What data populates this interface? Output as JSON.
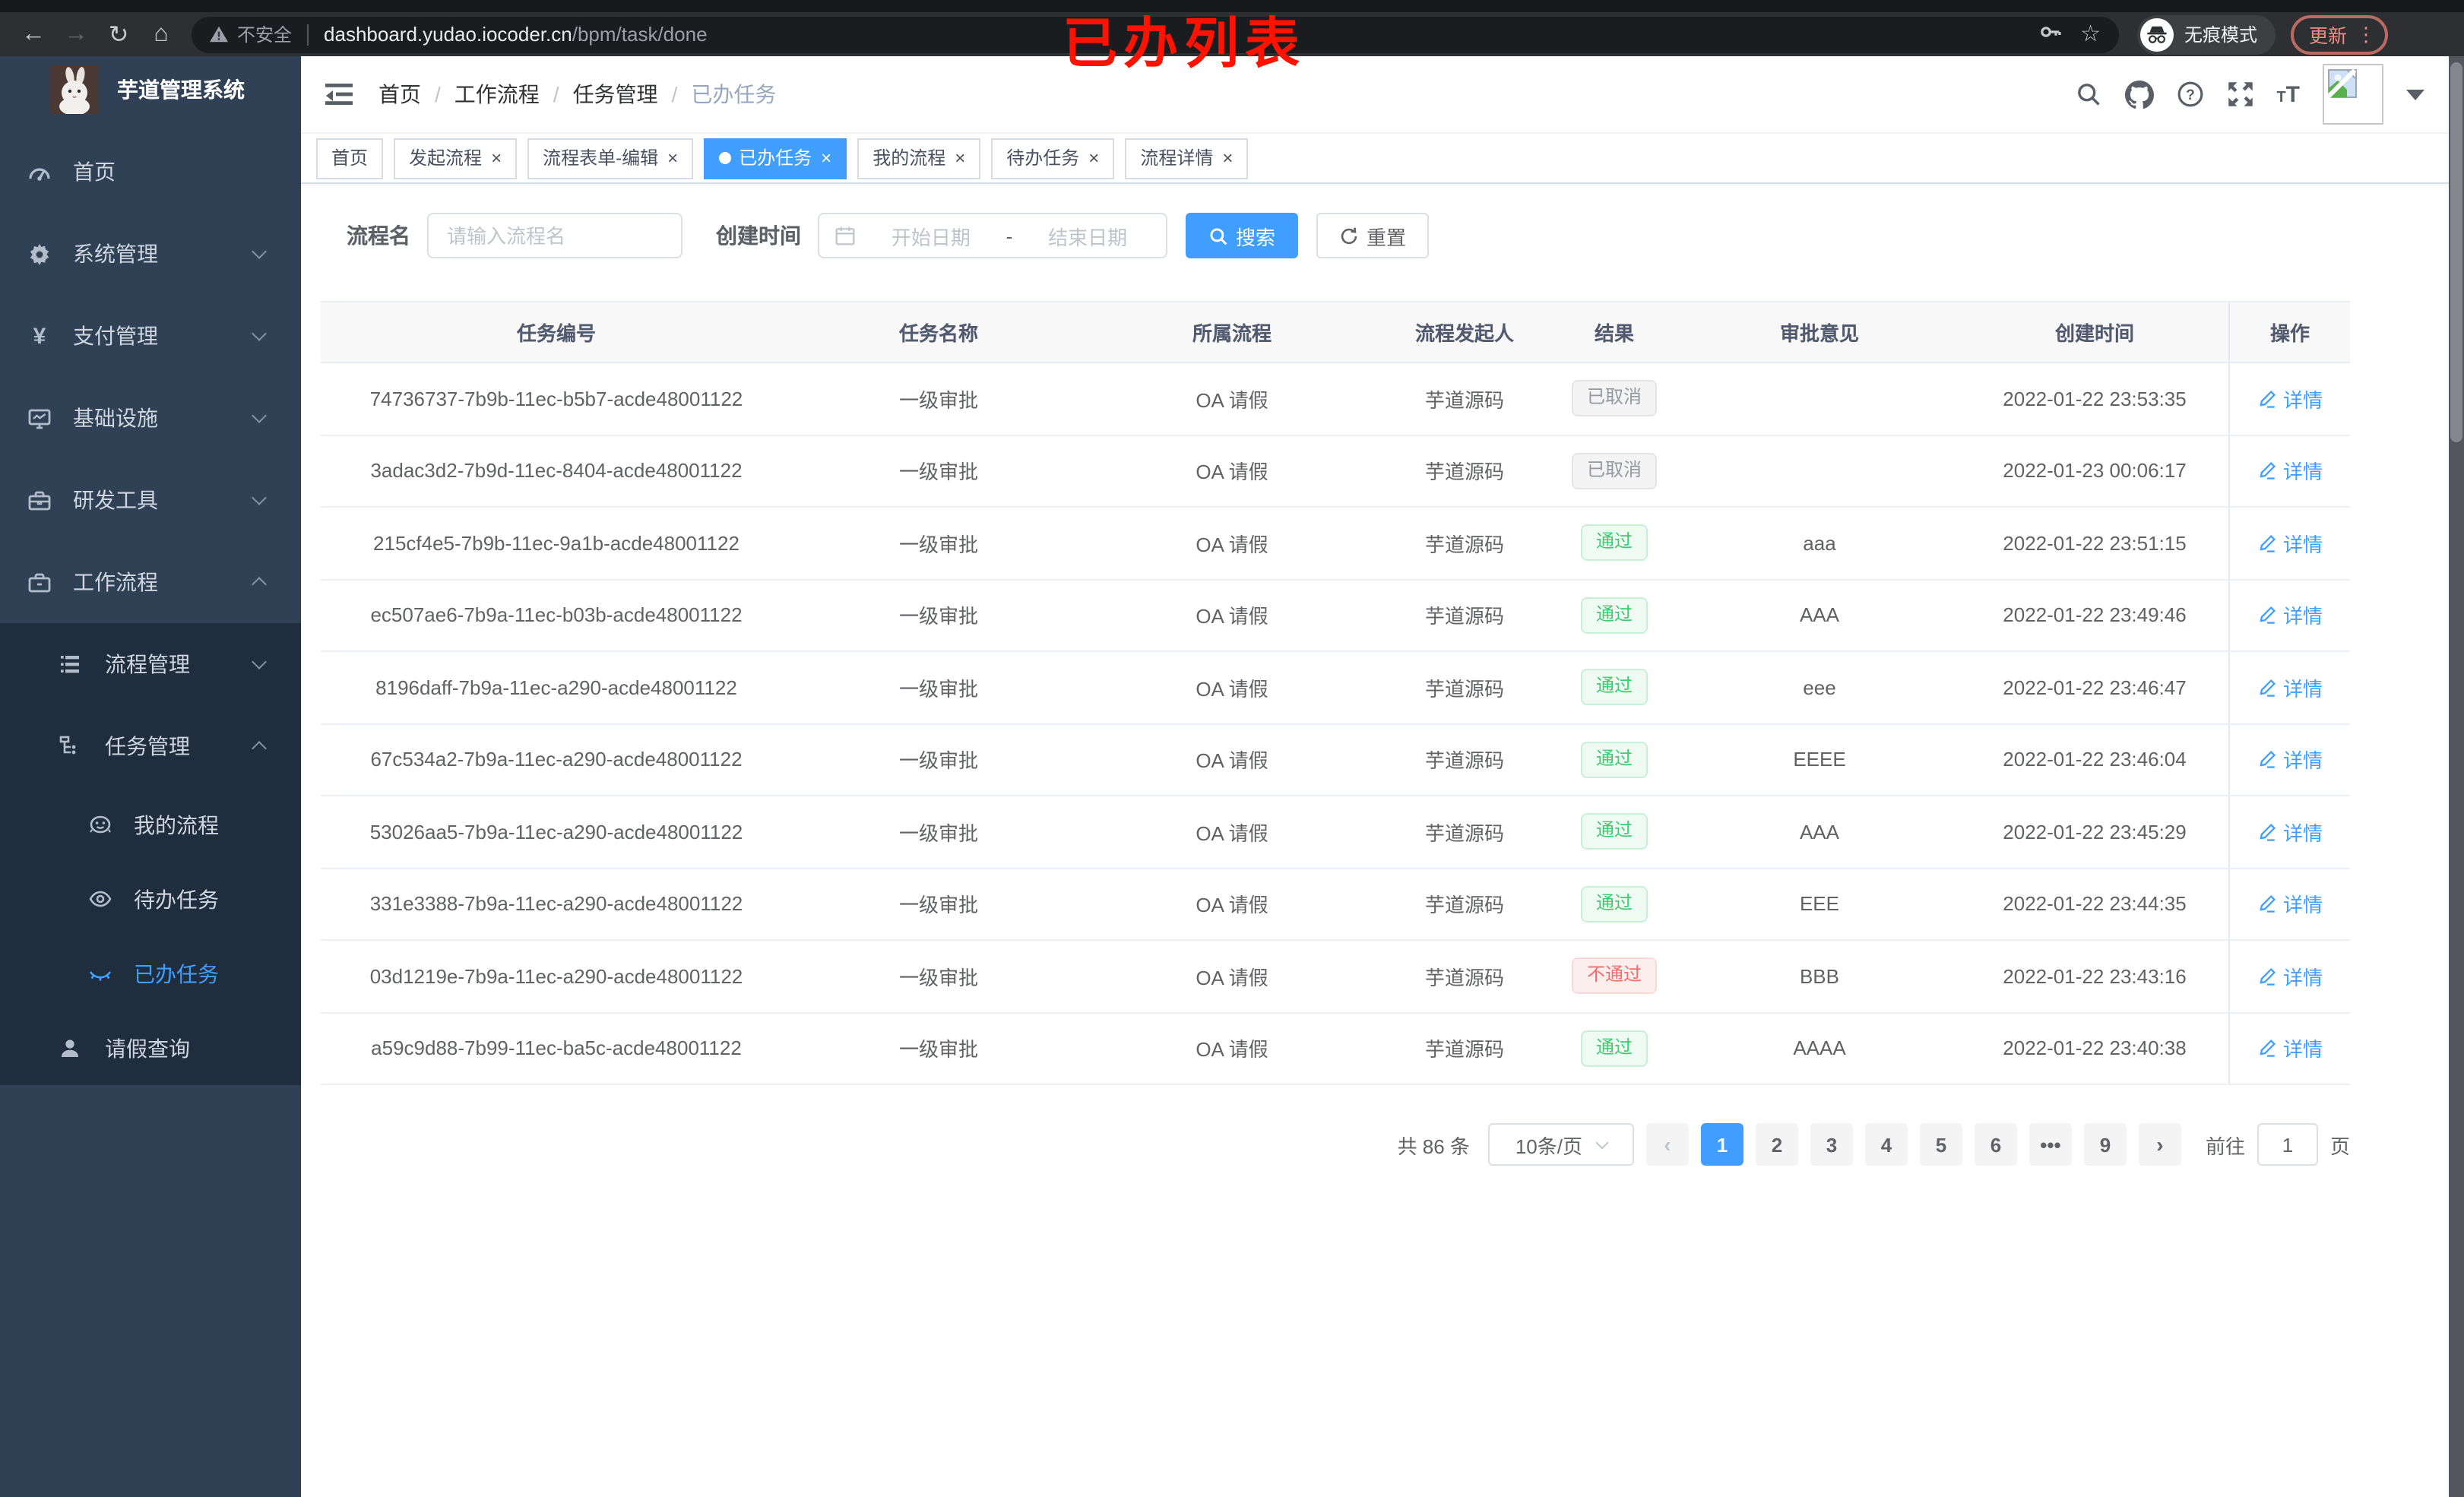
{
  "colors": {
    "accent": "#409eff",
    "success": "#3ecb72",
    "danger": "#f56c6c",
    "info": "#95989d",
    "sidebar_bg": "#304156",
    "submenu_bg": "#1f2d3d",
    "active_red": "#ff1300"
  },
  "browser": {
    "security_label": "不安全",
    "url_host": "dashboard.yudao.iocoder.cn",
    "url_path": "/bpm/task/done",
    "incognito_label": "无痕模式",
    "update_label": "更新",
    "update_dots": "⋮",
    "back_glyph": "←",
    "forward_glyph": "→",
    "reload_glyph": "↻",
    "home_glyph": "⌂",
    "star_glyph": "☆"
  },
  "annotation": "已办列表",
  "sidebar": {
    "title": "芋道管理系统",
    "menu": [
      {
        "label": "首页",
        "icon": "dashboard-icon"
      },
      {
        "label": "系统管理",
        "icon": "gear-icon"
      },
      {
        "label": "支付管理",
        "icon": "yen-icon"
      },
      {
        "label": "基础设施",
        "icon": "monitor-icon"
      },
      {
        "label": "研发工具",
        "icon": "toolbox-icon"
      },
      {
        "label": "工作流程",
        "icon": "briefcase-icon"
      },
      {
        "label": "流程管理",
        "icon": "list-icon"
      },
      {
        "label": "任务管理",
        "icon": "tree-icon"
      },
      {
        "label": "我的流程",
        "icon": "robot-icon"
      },
      {
        "label": "待办任务",
        "icon": "eye-icon"
      },
      {
        "label": "已办任务",
        "icon": "eye-closed-icon"
      },
      {
        "label": "请假查询",
        "icon": "user-icon"
      }
    ]
  },
  "breadcrumb": {
    "items": [
      "首页",
      "工作流程",
      "任务管理",
      "已办任务"
    ],
    "separator": "/"
  },
  "tabs": {
    "items": [
      {
        "label": "首页"
      },
      {
        "label": "发起流程"
      },
      {
        "label": "流程表单-编辑"
      },
      {
        "label": "已办任务"
      },
      {
        "label": "我的流程"
      },
      {
        "label": "待办任务"
      },
      {
        "label": "流程详情"
      }
    ],
    "close_glyph": "×"
  },
  "filter": {
    "name_label": "流程名",
    "name_placeholder": "请输入流程名",
    "time_label": "创建时间",
    "start_placeholder": "开始日期",
    "range_separator": "-",
    "end_placeholder": "结束日期",
    "search_label": "搜索",
    "reset_label": "重置"
  },
  "table": {
    "headers": [
      "任务编号",
      "任务名称",
      "所属流程",
      "流程发起人",
      "结果",
      "审批意见",
      "创建时间",
      "操作"
    ],
    "action_label": "详情",
    "rows": [
      {
        "id": "74736737-7b9b-11ec-b5b7-acde48001122",
        "name": "一级审批",
        "process": "OA 请假",
        "starter": "芋道源码",
        "result": "已取消",
        "comment": "",
        "time": "2022-01-22 23:53:35"
      },
      {
        "id": "3adac3d2-7b9d-11ec-8404-acde48001122",
        "name": "一级审批",
        "process": "OA 请假",
        "starter": "芋道源码",
        "result": "已取消",
        "comment": "",
        "time": "2022-01-23 00:06:17"
      },
      {
        "id": "215cf4e5-7b9b-11ec-9a1b-acde48001122",
        "name": "一级审批",
        "process": "OA 请假",
        "starter": "芋道源码",
        "result": "通过",
        "comment": "aaa",
        "time": "2022-01-22 23:51:15"
      },
      {
        "id": "ec507ae6-7b9a-11ec-b03b-acde48001122",
        "name": "一级审批",
        "process": "OA 请假",
        "starter": "芋道源码",
        "result": "通过",
        "comment": "AAA",
        "time": "2022-01-22 23:49:46"
      },
      {
        "id": "8196daff-7b9a-11ec-a290-acde48001122",
        "name": "一级审批",
        "process": "OA 请假",
        "starter": "芋道源码",
        "result": "通过",
        "comment": "eee",
        "time": "2022-01-22 23:46:47"
      },
      {
        "id": "67c534a2-7b9a-11ec-a290-acde48001122",
        "name": "一级审批",
        "process": "OA 请假",
        "starter": "芋道源码",
        "result": "通过",
        "comment": "EEEE",
        "time": "2022-01-22 23:46:04"
      },
      {
        "id": "53026aa5-7b9a-11ec-a290-acde48001122",
        "name": "一级审批",
        "process": "OA 请假",
        "starter": "芋道源码",
        "result": "通过",
        "comment": "AAA",
        "time": "2022-01-22 23:45:29"
      },
      {
        "id": "331e3388-7b9a-11ec-a290-acde48001122",
        "name": "一级审批",
        "process": "OA 请假",
        "starter": "芋道源码",
        "result": "通过",
        "comment": "EEE",
        "time": "2022-01-22 23:44:35"
      },
      {
        "id": "03d1219e-7b9a-11ec-a290-acde48001122",
        "name": "一级审批",
        "process": "OA 请假",
        "starter": "芋道源码",
        "result": "不通过",
        "comment": "BBB",
        "time": "2022-01-22 23:43:16"
      },
      {
        "id": "a59c9d88-7b99-11ec-ba5c-acde48001122",
        "name": "一级审批",
        "process": "OA 请假",
        "starter": "芋道源码",
        "result": "通过",
        "comment": "AAAA",
        "time": "2022-01-22 23:40:38"
      }
    ]
  },
  "pagination": {
    "total_text": "共 86 条",
    "page_size": "10条/页",
    "prev_glyph": "‹",
    "next_glyph": "›",
    "pages": [
      "1",
      "2",
      "3",
      "4",
      "5",
      "6",
      "•••",
      "9"
    ],
    "goto_label": "前往",
    "goto_value": "1",
    "goto_unit": "页"
  }
}
